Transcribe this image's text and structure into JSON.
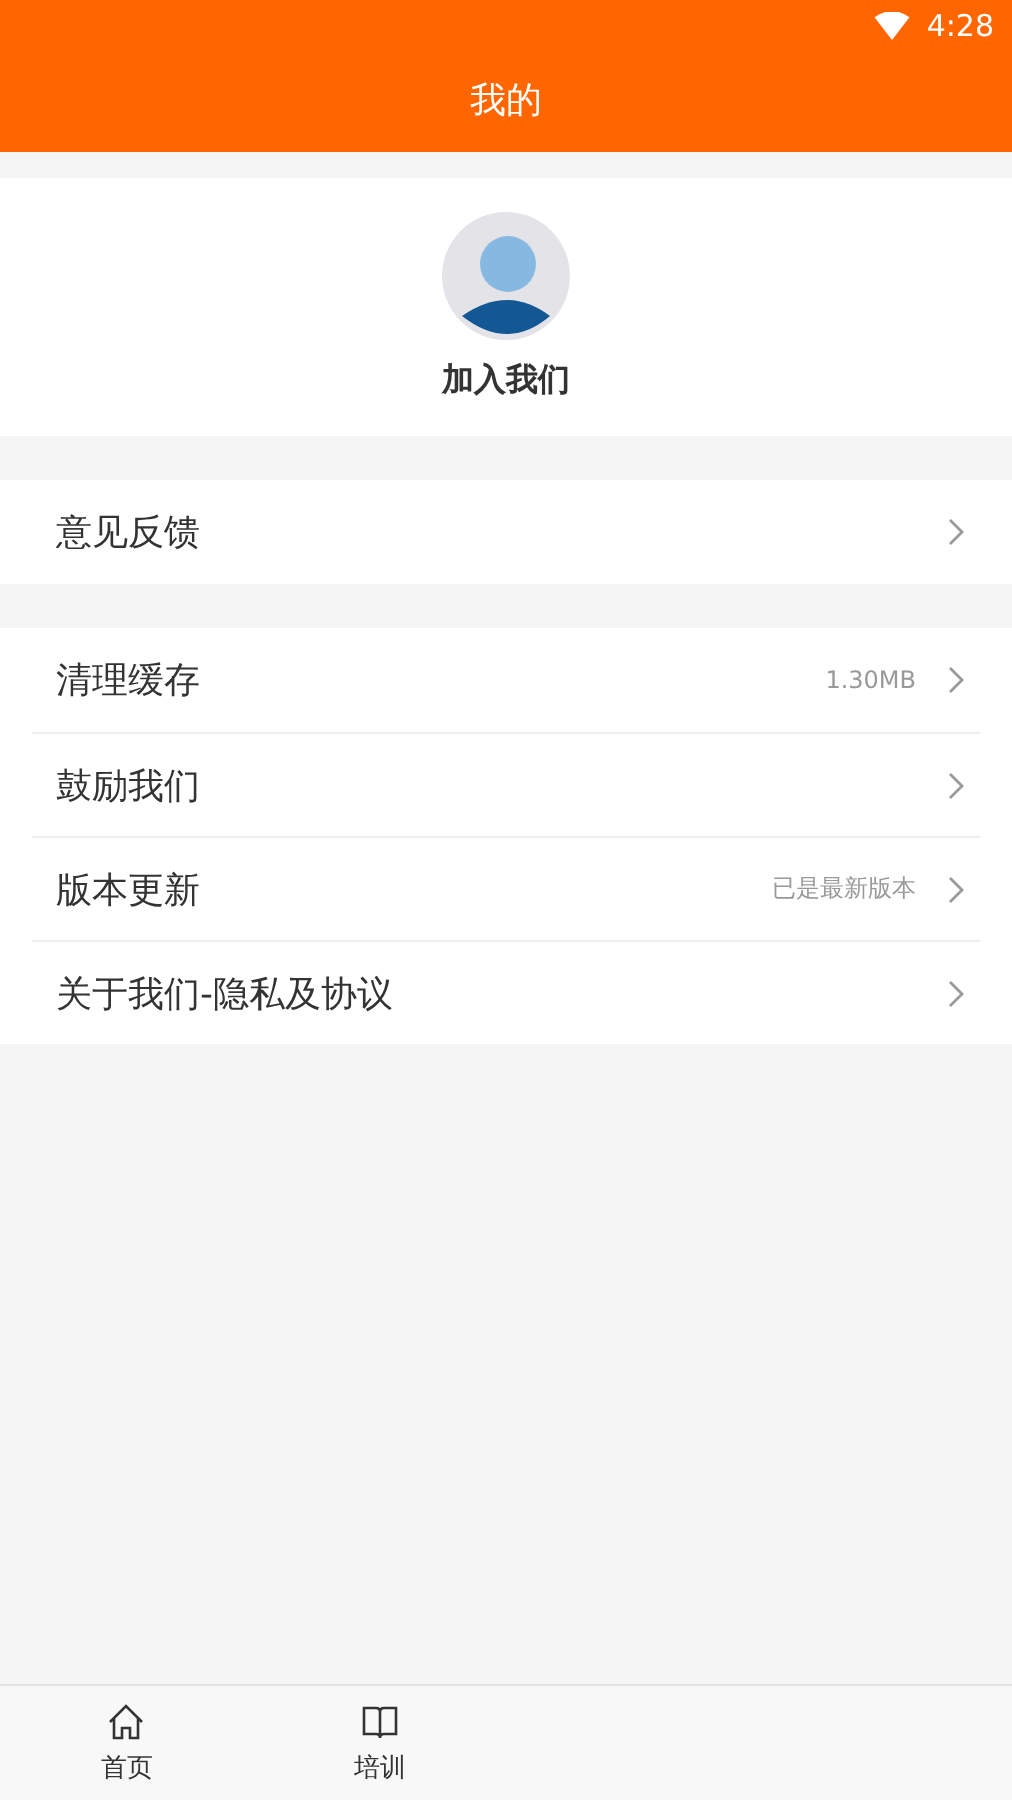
{
  "status_bar": {
    "time": "4:28"
  },
  "title": "我的",
  "profile": {
    "name": "加入我们"
  },
  "groups": [
    {
      "items": [
        {
          "label": "意见反馈"
        }
      ]
    },
    {
      "items": [
        {
          "label": "清理缓存",
          "value": "1.30MB"
        },
        {
          "label": "鼓励我们"
        },
        {
          "label": "版本更新",
          "value": "已是最新版本"
        },
        {
          "label": "关于我们-隐私及协议"
        }
      ]
    }
  ],
  "tabs": [
    {
      "label": "首页",
      "kind": "home",
      "selected": false
    },
    {
      "label": "培训",
      "kind": "book",
      "selected": false
    }
  ]
}
